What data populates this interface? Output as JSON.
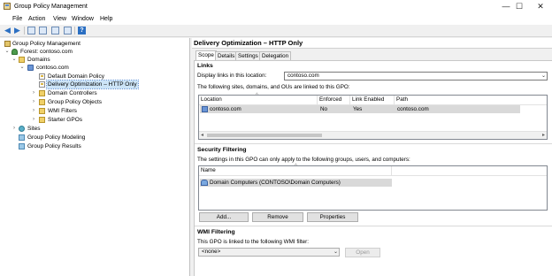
{
  "window": {
    "title": "Group Policy Management",
    "controls": {
      "minimize": "—",
      "maximize": "☐",
      "close": "✕"
    }
  },
  "menu": [
    "File",
    "Action",
    "View",
    "Window",
    "Help"
  ],
  "toolbar": {
    "icons": [
      "back-arrow-icon",
      "forward-arrow-icon",
      "folder-up-icon",
      "show-hide-tree-icon",
      "refresh-icon",
      "properties-icon",
      "help-icon"
    ],
    "help_glyph": "?"
  },
  "tree": {
    "items": [
      {
        "label": "Group Policy Management",
        "icon": "gpm-icon",
        "expander": ""
      },
      {
        "label": "Forest: contoso.com",
        "icon": "forest-icon",
        "expander": "⌄"
      },
      {
        "label": "Domains",
        "icon": "folder-icon",
        "expander": "⌄"
      },
      {
        "label": "contoso.com",
        "icon": "domain-icon",
        "expander": "⌄"
      },
      {
        "label": "Default Domain Policy",
        "icon": "gpo-link-icon",
        "expander": ""
      },
      {
        "label": "Delivery Optimization – HTTP Only",
        "icon": "gpo-link-icon",
        "expander": "",
        "selected": true
      },
      {
        "label": "Domain Controllers",
        "icon": "folder-icon",
        "expander": "›"
      },
      {
        "label": "Group Policy Objects",
        "icon": "folder-icon",
        "expander": "›"
      },
      {
        "label": "WMI Filters",
        "icon": "folder-icon",
        "expander": "›"
      },
      {
        "label": "Starter GPOs",
        "icon": "folder-icon",
        "expander": "›"
      },
      {
        "label": "Sites",
        "icon": "sites-icon",
        "expander": "›"
      },
      {
        "label": "Group Policy Modeling",
        "icon": "modeling-icon",
        "expander": ""
      },
      {
        "label": "Group Policy Results",
        "icon": "results-icon",
        "expander": ""
      }
    ]
  },
  "details": {
    "header": "Delivery Optimization – HTTP Only",
    "tabs": [
      "Scope",
      "Details",
      "Settings",
      "Delegation"
    ],
    "active_tab": "Scope",
    "links": {
      "title": "Links",
      "display_label": "Display links in this location:",
      "display_value": "contoso.com",
      "description": "The following sites, domains, and OUs are linked to this GPO:",
      "columns": [
        "Location",
        "Enforced",
        "Link Enabled",
        "Path"
      ],
      "rows": [
        {
          "location": "contoso.com",
          "enforced": "No",
          "link_enabled": "Yes",
          "path": "contoso.com"
        }
      ]
    },
    "security": {
      "title": "Security Filtering",
      "description": "The settings in this GPO can only apply to the following groups, users, and computers:",
      "columns": [
        "Name"
      ],
      "rows": [
        {
          "name": "Domain Computers (CONTOSO\\Domain Computers)"
        }
      ],
      "buttons": {
        "add": "Add...",
        "remove": "Remove",
        "properties": "Properties"
      }
    },
    "wmi": {
      "title": "WMI Filtering",
      "description": "This GPO is linked to the following WMI filter:",
      "value": "<none>",
      "open_button": "Open"
    }
  },
  "colors": {
    "selection": "#cce4f7",
    "row_highlight": "#d9d9d9",
    "accent": "#2b6fc2"
  }
}
